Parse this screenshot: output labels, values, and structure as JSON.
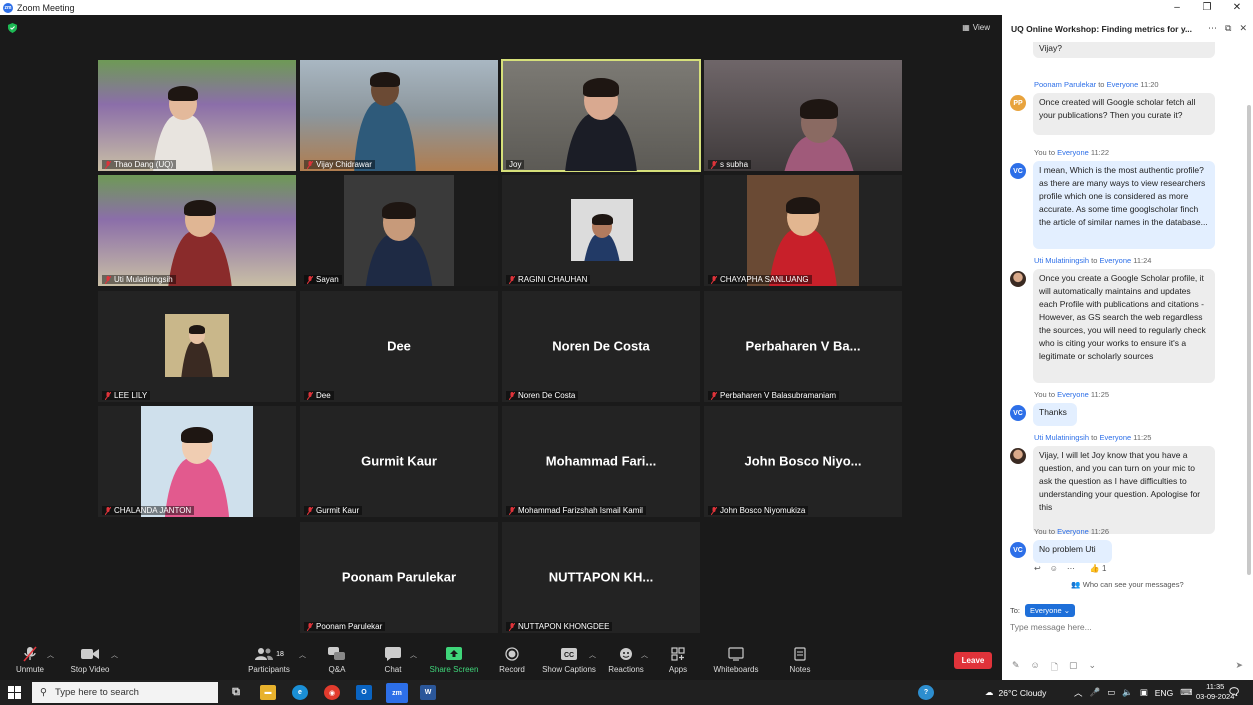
{
  "window": {
    "title": "Zoom Meeting",
    "minimize": "–",
    "maximize": "❐",
    "close": "✕"
  },
  "view_label": "View",
  "participants": [
    {
      "name": "Thao Dang (UQ)",
      "type": "video",
      "muted": true
    },
    {
      "name": "Vijay Chidrawar",
      "type": "video",
      "muted": true
    },
    {
      "name": "Joy",
      "type": "video",
      "muted": false,
      "active_speaker": true
    },
    {
      "name": "s subha",
      "type": "video",
      "muted": true
    },
    {
      "name": "Uti Mulatiningsih",
      "type": "video",
      "muted": true
    },
    {
      "name": "Sayan",
      "type": "photo",
      "muted": true
    },
    {
      "name": "RAGINI CHAUHAN",
      "type": "photo",
      "muted": true
    },
    {
      "name": "CHAYAPHA SANLUANG",
      "type": "photo",
      "muted": true
    },
    {
      "name": "LEE LILY",
      "type": "photo",
      "muted": true
    },
    {
      "name": "Dee",
      "display": "Dee",
      "type": "name",
      "muted": true
    },
    {
      "name": "Noren De Costa",
      "display": "Noren De Costa",
      "type": "name",
      "muted": true
    },
    {
      "name": "Perbaharen V Balasubramaniam",
      "display": "Perbaharen V Ba...",
      "type": "name",
      "muted": true
    },
    {
      "name": "CHALANDA JANTON",
      "type": "photo",
      "muted": true
    },
    {
      "name": "Gurmit Kaur",
      "display": "Gurmit Kaur",
      "type": "name",
      "muted": true
    },
    {
      "name": "Mohammad Farizshah Ismail Kamil",
      "display": "Mohammad  Fari...",
      "type": "name",
      "muted": true
    },
    {
      "name": "John Bosco Niyomukiza",
      "display": "John Bosco  Niyo...",
      "type": "name",
      "muted": true
    },
    {
      "name": "Poonam Parulekar",
      "display": "Poonam Parulekar",
      "type": "name",
      "muted": true
    },
    {
      "name": "NUTTAPON KHONGDEE",
      "display": "NUTTAPON  KH...",
      "type": "name",
      "muted": true
    }
  ],
  "toolbar": {
    "unmute": "Unmute",
    "stop_video": "Stop Video",
    "participants": "Participants",
    "participants_count": "18",
    "qa": "Q&A",
    "chat": "Chat",
    "share_screen": "Share Screen",
    "record": "Record",
    "captions": "Show Captions",
    "reactions": "Reactions",
    "apps": "Apps",
    "whiteboards": "Whiteboards",
    "notes": "Notes",
    "leave": "Leave"
  },
  "chat": {
    "title": "UQ Online Workshop: Finding metrics for y...",
    "messages": [
      {
        "sender": "",
        "to": "",
        "time": "",
        "avatar": "UM",
        "text": "Could  you please elaborate your question, Vijay?",
        "me": false
      },
      {
        "sender": "Poonam Parulekar",
        "to": "Everyone",
        "time": "11:20",
        "avatar": "PP",
        "text": "Once created will Google scholar fetch all your publications? Then you curate it?",
        "me": false
      },
      {
        "sender": "You",
        "to": "Everyone",
        "time": "11:22",
        "avatar": "VC",
        "text": "I mean, Which is the most authentic profile? as there are many ways to view researchers profile which one is considered as more accurate. As some time googlscholar finch the article of similar names in the database...",
        "me": true
      },
      {
        "sender": "Uti Mulatiningsih",
        "to": "Everyone",
        "time": "11:24",
        "avatar": "UM",
        "text": "Once you create a Google Scholar profile, it will automatically maintains and updates each Profile with publications and citations - However, as GS search the web regardless the sources, you will need to regularly check who is citing your works to ensure it's a legitimate or scholarly sources",
        "me": false
      },
      {
        "sender": "You",
        "to": "Everyone",
        "time": "11:25",
        "avatar": "VC",
        "text": "Thanks",
        "me": true
      },
      {
        "sender": "Uti Mulatiningsih",
        "to": "Everyone",
        "time": "11:25",
        "avatar": "UM",
        "text": "Vijay, I will let Joy know that you have a question, and you can turn on your mic to ask the question as I have difficulties to understanding your question. Apologise for this",
        "me": false
      },
      {
        "sender": "You",
        "to": "Everyone",
        "time": "11:26",
        "avatar": "VC",
        "text": "No problem Uti",
        "me": true
      }
    ],
    "reaction": "👍 1",
    "who_can_see": "Who can see your messages?",
    "to_label": "To:",
    "to_value": "Everyone",
    "to_word": "to",
    "placeholder": "Type message here..."
  },
  "taskbar": {
    "search_placeholder": "Type here to search",
    "weather": "26°C  Cloudy",
    "lang": "ENG",
    "time": "11:35",
    "date": "03-09-2024",
    "notif_count": "2"
  },
  "colors": {
    "accent": "#2d6fe8",
    "leave": "#e0333a",
    "share": "#3fd67a",
    "active": "#d6e07a"
  }
}
